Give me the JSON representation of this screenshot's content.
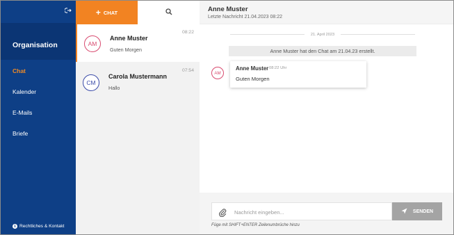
{
  "sidebar": {
    "org_title": "Organisation",
    "items": [
      {
        "label": "Chat",
        "active": true
      },
      {
        "label": "Kalender"
      },
      {
        "label": "E-Mails"
      },
      {
        "label": "Briefe"
      }
    ],
    "footer_label": "Rechtliches & Kontakt",
    "logout_icon": "logout-icon"
  },
  "chatlist": {
    "new_chat_label": "CHAT",
    "search_icon": "search-icon",
    "chats": [
      {
        "initials": "AM",
        "name": "Anne Muster",
        "preview": "Guten Morgen",
        "time": "08:22"
      },
      {
        "initials": "CM",
        "name": "Carola Mustermann",
        "preview": "Hallo",
        "time": "07:54"
      }
    ]
  },
  "chat": {
    "header_name": "Anne Muster",
    "header_sub": "Letzte Nachricht 21.04.2023 08:22",
    "date_separator": "21. April 2023",
    "system_message": "Anne Muster hat den Chat am 21.04.23 erstellt.",
    "message": {
      "initials": "AM",
      "sender": "Anne Muster",
      "time": "08:22 Uhr",
      "text": "Guten Morgen"
    }
  },
  "composer": {
    "placeholder": "Nachricht eingeben...",
    "value": "",
    "send_label": "SENDEN",
    "hint": "Füge mit SHIFT+ENTER Zeilenumbrüche hinzu"
  },
  "colors": {
    "sidebar_bg": "#0e3f86",
    "accent_orange": "#f28322",
    "avatar_am": "#d84a6f",
    "avatar_cm": "#3a4aa8",
    "send_disabled": "#a4a4a4"
  }
}
